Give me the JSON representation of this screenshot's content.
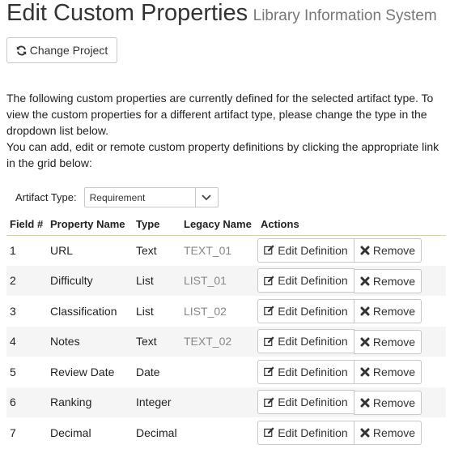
{
  "header": {
    "title": "Edit Custom Properties",
    "subtitle": "Library Information System"
  },
  "toolbar": {
    "change_project_label": "Change Project",
    "change_project_icon": "refresh-icon"
  },
  "intro": {
    "line1": "The following custom properties are currently defined for the selected artifact type. To view the custom properties for a different artifact type, please change the type in the dropdown list below.",
    "line2": "You can add, edit or remote custom property definitions by clicking the appropriate link in the grid below:"
  },
  "filter": {
    "label": "Artifact Type:",
    "selected": "Requirement"
  },
  "grid": {
    "columns": [
      "Field #",
      "Property Name",
      "Type",
      "Legacy Name",
      "Actions"
    ],
    "edit_label": "Edit Definition",
    "remove_label": "Remove",
    "rows": [
      {
        "field": "1",
        "name": "URL",
        "type": "Text",
        "legacy": "TEXT_01"
      },
      {
        "field": "2",
        "name": "Difficulty",
        "type": "List",
        "legacy": "LIST_01"
      },
      {
        "field": "3",
        "name": "Classification",
        "type": "List",
        "legacy": "LIST_02"
      },
      {
        "field": "4",
        "name": "Notes",
        "type": "Text",
        "legacy": "TEXT_02"
      },
      {
        "field": "5",
        "name": "Review Date",
        "type": "Date",
        "legacy": ""
      },
      {
        "field": "6",
        "name": "Ranking",
        "type": "Integer",
        "legacy": ""
      },
      {
        "field": "7",
        "name": "Decimal",
        "type": "Decimal",
        "legacy": ""
      }
    ]
  }
}
